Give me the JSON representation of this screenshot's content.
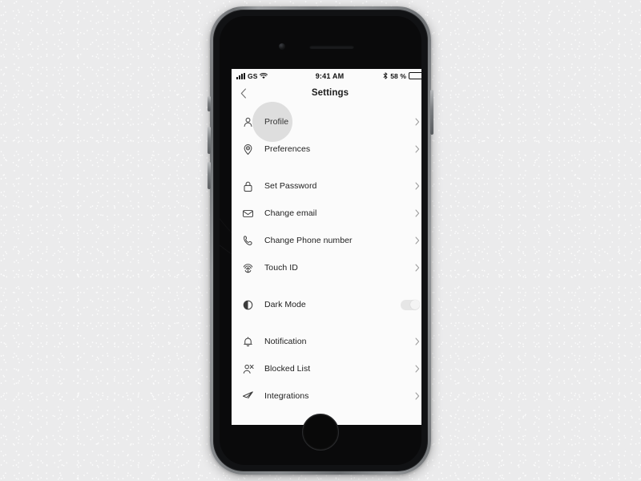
{
  "device": {
    "label": "smartphone-mockup"
  },
  "status_bar": {
    "carrier": "GS",
    "signal_icon": "signal-bars-icon",
    "wifi_icon": "wifi-icon",
    "time": "9:41 AM",
    "bluetooth_icon": "bluetooth-icon",
    "battery_percent_label": "58 %",
    "battery_level": 58,
    "battery_icon": "battery-icon"
  },
  "nav": {
    "back_icon": "chevron-left-icon",
    "title": "Settings"
  },
  "groups": [
    {
      "name": "account-group",
      "rows": [
        {
          "id": "profile",
          "label": "Profile",
          "icon": "person-icon",
          "accessory": "chevron",
          "pressed": true
        },
        {
          "id": "preferences",
          "label": "Preferences",
          "icon": "target-pin-icon",
          "accessory": "chevron",
          "pressed": false
        }
      ]
    },
    {
      "name": "security-group",
      "rows": [
        {
          "id": "set-password",
          "label": "Set Password",
          "icon": "lock-icon",
          "accessory": "chevron",
          "pressed": false
        },
        {
          "id": "change-email",
          "label": "Change email",
          "icon": "envelope-icon",
          "accessory": "chevron",
          "pressed": false
        },
        {
          "id": "change-phone",
          "label": "Change Phone number",
          "icon": "phone-icon",
          "accessory": "chevron",
          "pressed": false
        },
        {
          "id": "touch-id",
          "label": "Touch ID",
          "icon": "fingerprint-icon",
          "accessory": "chevron",
          "pressed": false
        }
      ]
    },
    {
      "name": "appearance-group",
      "rows": [
        {
          "id": "dark-mode",
          "label": "Dark Mode",
          "icon": "half-circle-icon",
          "accessory": "switch",
          "switch_state": "off",
          "pressed": false
        }
      ]
    },
    {
      "name": "more-group",
      "rows": [
        {
          "id": "notification",
          "label": "Notification",
          "icon": "bell-icon",
          "accessory": "chevron",
          "pressed": false
        },
        {
          "id": "blocked-list",
          "label": "Blocked List",
          "icon": "person-blocked-icon",
          "accessory": "chevron",
          "pressed": false
        },
        {
          "id": "integrations",
          "label": "Integrations",
          "icon": "paper-plane-icon",
          "accessory": "chevron",
          "pressed": false
        }
      ]
    }
  ],
  "colors": {
    "backdrop": "#ebebec",
    "device_frame": "#8a8d90",
    "device_bezel": "#0a0a0b",
    "screen_bg": "#fbfbfb",
    "label_text": "#1e1e1e",
    "icon": "#3b3b3b",
    "chevron": "#9a9a9a",
    "switch_track_off": "#e6e6e6",
    "switch_knob_off": "#f4f4f4",
    "ripple": "rgba(120,120,120,0.22)"
  }
}
